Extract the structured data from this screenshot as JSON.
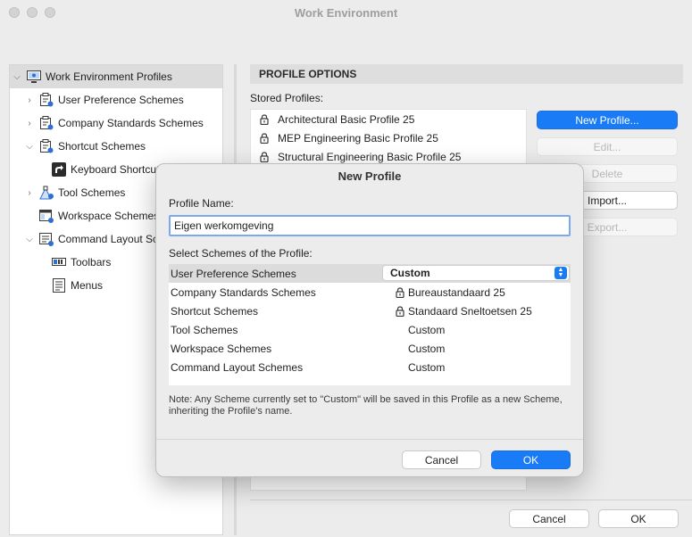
{
  "window": {
    "title": "Work Environment"
  },
  "tree": {
    "items": [
      {
        "label": "Work Environment Profiles",
        "icon": "monitor-icon"
      },
      {
        "label": "User Preference Schemes",
        "icon": "scheme-icon"
      },
      {
        "label": "Company Standards Schemes",
        "icon": "scheme-icon"
      },
      {
        "label": "Shortcut Schemes",
        "icon": "scheme-icon"
      },
      {
        "label": "Keyboard Shortcuts",
        "icon": "keyboard-shortcut-icon"
      },
      {
        "label": "Tool Schemes",
        "icon": "tool-scheme-icon"
      },
      {
        "label": "Workspace Schemes",
        "icon": "workspace-scheme-icon"
      },
      {
        "label": "Command Layout Schemes",
        "icon": "command-layout-icon"
      },
      {
        "label": "Toolbars",
        "icon": "toolbar-icon"
      },
      {
        "label": "Menus",
        "icon": "menu-icon"
      }
    ]
  },
  "options": {
    "header": "PROFILE OPTIONS",
    "stored_label": "Stored Profiles:",
    "profiles": [
      "Architectural Basic Profile 25",
      "MEP Engineering Basic Profile 25",
      "Structural Engineering Basic Profile 25"
    ],
    "buttons": {
      "new": "New Profile...",
      "edit": "Edit...",
      "delete": "Delete",
      "import": "Import...",
      "export": "Export..."
    }
  },
  "footer": {
    "cancel": "Cancel",
    "ok": "OK"
  },
  "modal": {
    "title": "New Profile",
    "name_label": "Profile Name:",
    "name_value": "Eigen werkomgeving",
    "schemes_label": "Select Schemes of the Profile:",
    "schemes": [
      {
        "name": "User Preference Schemes",
        "value": "Custom"
      },
      {
        "name": "Company Standards Schemes",
        "value": "Bureaustandaard 25"
      },
      {
        "name": "Shortcut Schemes",
        "value": "Standaard Sneltoetsen 25"
      },
      {
        "name": "Tool Schemes",
        "value": "Custom"
      },
      {
        "name": "Workspace Schemes",
        "value": "Custom"
      },
      {
        "name": "Command Layout Schemes",
        "value": "Custom"
      }
    ],
    "note": "Note: Any Scheme currently set to \"Custom\" will be saved in this Profile as a new Scheme, inheriting the Profile's name.",
    "cancel": "Cancel",
    "ok": "OK"
  },
  "colors": {
    "accent": "#1a7bf6",
    "selection": "#dcdcdc"
  }
}
